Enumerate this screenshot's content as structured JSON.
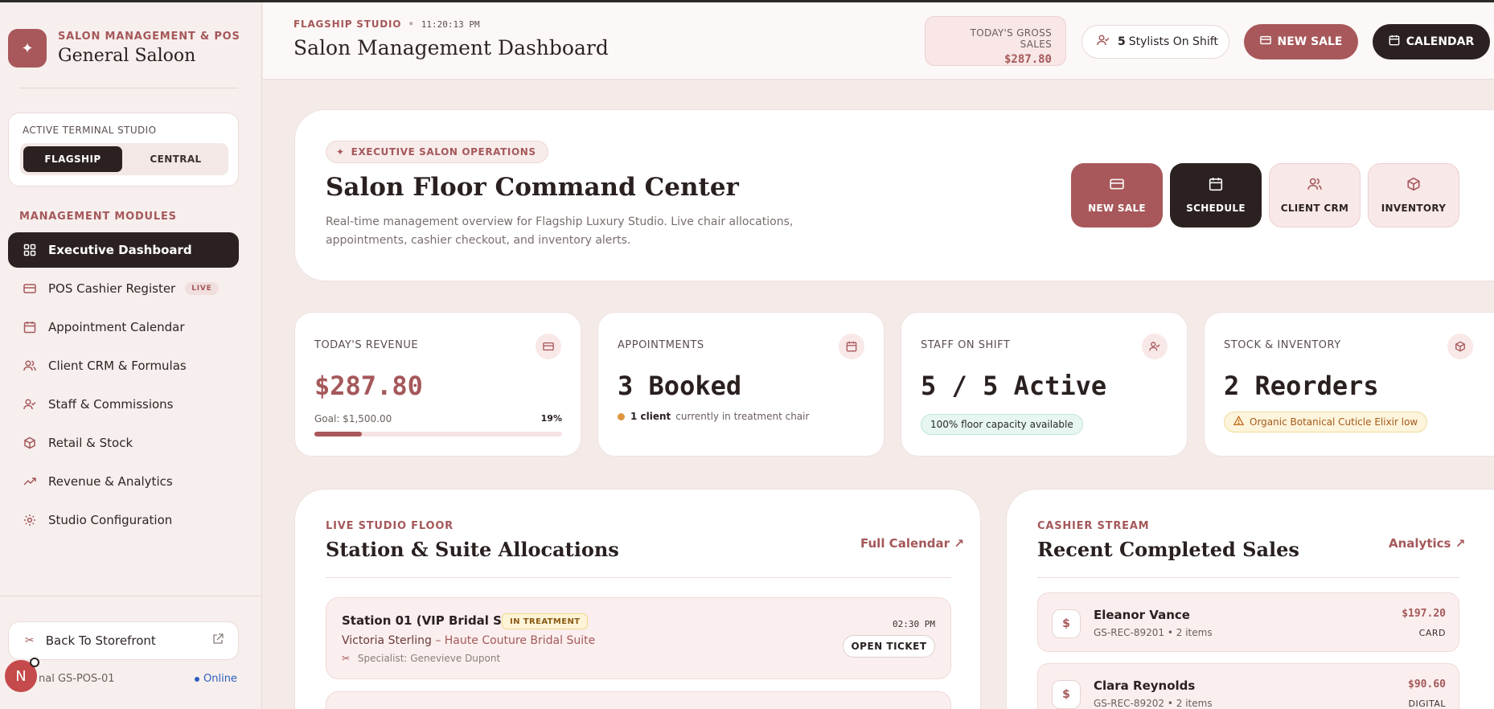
{
  "brand": {
    "subtitle": "SALON MANAGEMENT & POS",
    "title": "General Saloon"
  },
  "terminal": {
    "label": "ACTIVE TERMINAL STUDIO",
    "options": [
      "FLAGSHIP",
      "CENTRAL"
    ],
    "selected": "FLAGSHIP",
    "id": "nal GS-POS-01",
    "status": "Online"
  },
  "sidebar": {
    "section_label": "MANAGEMENT MODULES",
    "items": [
      {
        "label": "Executive Dashboard",
        "icon": "grid-icon",
        "active": true
      },
      {
        "label": "POS Cashier Register",
        "icon": "credit-card-icon",
        "badge": "LIVE"
      },
      {
        "label": "Appointment Calendar",
        "icon": "calendar-icon"
      },
      {
        "label": "Client CRM & Formulas",
        "icon": "users-icon"
      },
      {
        "label": "Staff & Commissions",
        "icon": "user-check-icon"
      },
      {
        "label": "Retail & Stock",
        "icon": "box-icon"
      },
      {
        "label": "Revenue & Analytics",
        "icon": "trending-up-icon"
      },
      {
        "label": "Studio Configuration",
        "icon": "gear-icon"
      }
    ],
    "storefront_label": "Back To Storefront",
    "avatar_letter": "N"
  },
  "topbar": {
    "eyebrow": "FLAGSHIP STUDIO",
    "clock": "11:20:13 PM",
    "title": "Salon Management Dashboard",
    "gross_label": "TODAY'S GROSS SALES",
    "gross_value": "$287.80",
    "stylists_count": "5",
    "stylists_label": "Stylists On Shift",
    "new_sale": "NEW SALE",
    "calendar": "CALENDAR"
  },
  "hero": {
    "tag": "EXECUTIVE SALON OPERATIONS",
    "title": "Salon Floor Command Center",
    "description": "Real-time management overview for Flagship Luxury Studio. Live chair allocations, appointments, cashier checkout, and inventory alerts.",
    "actions": [
      "NEW SALE",
      "SCHEDULE",
      "CLIENT CRM",
      "INVENTORY"
    ]
  },
  "stats": {
    "revenue": {
      "label": "TODAY'S REVENUE",
      "value": "$287.80",
      "goal": "Goal: $1,500.00",
      "pct": "19%",
      "progress": 0.19
    },
    "appointments": {
      "label": "APPOINTMENTS",
      "value": "3 Booked",
      "client_count": "1 client",
      "client_note": "currently in treatment chair"
    },
    "staff": {
      "label": "STAFF ON SHIFT",
      "value": "5 / 5 Active",
      "note": "100% floor capacity available"
    },
    "stock": {
      "label": "STOCK & INVENTORY",
      "value": "2 Reorders",
      "note": "Organic Botanical Cuticle Elixir low"
    }
  },
  "floor": {
    "eyebrow": "LIVE STUDIO FLOOR",
    "title": "Station & Suite Allocations",
    "link": "Full Calendar",
    "stations": [
      {
        "name": "Station 01 (VIP Bridal Suite)",
        "status": "IN TREATMENT",
        "client": "Victoria Sterling",
        "service": "Haute Couture Bridal Suite",
        "specialist": "Specialist: Genevieve Dupont",
        "time": "02:30 PM",
        "action": "OPEN TICKET"
      }
    ]
  },
  "sales": {
    "eyebrow": "CASHIER STREAM",
    "title": "Recent Completed Sales",
    "link": "Analytics",
    "items": [
      {
        "name": "Eleanor Vance",
        "meta": "GS-REC-89201 • 2 items",
        "amount": "$197.20",
        "method": "CARD"
      },
      {
        "name": "Clara Reynolds",
        "meta": "GS-REC-89202 • 2 items",
        "amount": "$90.60",
        "method": "DIGITAL"
      }
    ]
  },
  "colors": {
    "accent": "#a8585a",
    "dark": "#2b2120",
    "background": "#f4ebe9"
  }
}
